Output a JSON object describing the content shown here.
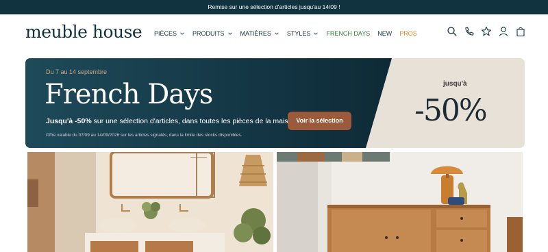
{
  "topbar": {
    "promo": "Remise sur une sélection d'articles jusqu'au 14/09 !"
  },
  "header": {
    "logo": "meuble house",
    "nav": [
      {
        "label": "PIÈCES",
        "has_dropdown": true
      },
      {
        "label": "PRODUITS",
        "has_dropdown": true
      },
      {
        "label": "MATIÈRES",
        "has_dropdown": true
      },
      {
        "label": "STYLES",
        "has_dropdown": true
      },
      {
        "label": "FRENCH DAYS",
        "has_dropdown": false,
        "color": "#2f7d34"
      },
      {
        "label": "NEW",
        "has_dropdown": false
      },
      {
        "label": "PROS",
        "has_dropdown": false,
        "color": "#e08a2a"
      }
    ],
    "icons": [
      "search-icon",
      "phone-icon",
      "star-icon",
      "account-icon",
      "cart-icon"
    ]
  },
  "banner": {
    "date": "Du 7 au 14 septembre",
    "title": "French Days",
    "text_bold": "Jusqu'à -50%",
    "text_rest": " sur une sélection d'articles, dans toutes les pièces de la maison.",
    "fine_print": "Offre valable du 07/09 au 14/09/2026 sur les articles signalés, dans la limite des stocks disponibles.",
    "button": "Voir la sélection",
    "upto": "jusqu'à",
    "percent": "-50%"
  },
  "colors": {
    "dark_blue": "#11323f",
    "cta_brown": "#9b5a3c",
    "french_days_green": "#2f7d34",
    "pros_orange": "#e08a2a",
    "beige": "#e8e1d8"
  }
}
